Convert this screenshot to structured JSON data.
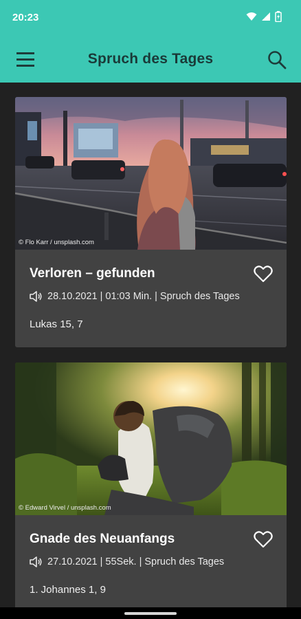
{
  "status_bar": {
    "time": "20:23",
    "icons": [
      "wifi-icon",
      "signal-icon",
      "battery-icon"
    ]
  },
  "app_bar": {
    "title": "Spruch des Tages",
    "menu_icon": "menu-icon",
    "search_icon": "search-icon"
  },
  "cards": [
    {
      "title": "Verloren – gefunden",
      "date": "28.10.2021",
      "duration": "01:03 Min.",
      "category": "Spruch des Tages",
      "meta": "28.10.2021 | 01:03 Min. | Spruch des Tages",
      "verse": "Lukas 15, 7",
      "photo_credit": "© Flo Karr / unsplash.com",
      "favorite": false
    },
    {
      "title": "Gnade des Neuanfangs",
      "date": "27.10.2021",
      "duration": "55Sek.",
      "category": "Spruch des Tages",
      "meta": "27.10.2021 | 55Sek. | Spruch des Tages",
      "verse": "1. Johannes 1, 9",
      "photo_credit": "© Edward Virvel / unsplash.com",
      "favorite": false
    }
  ],
  "colors": {
    "accent": "#3cc8b4",
    "background": "#212121",
    "card": "#424242"
  }
}
